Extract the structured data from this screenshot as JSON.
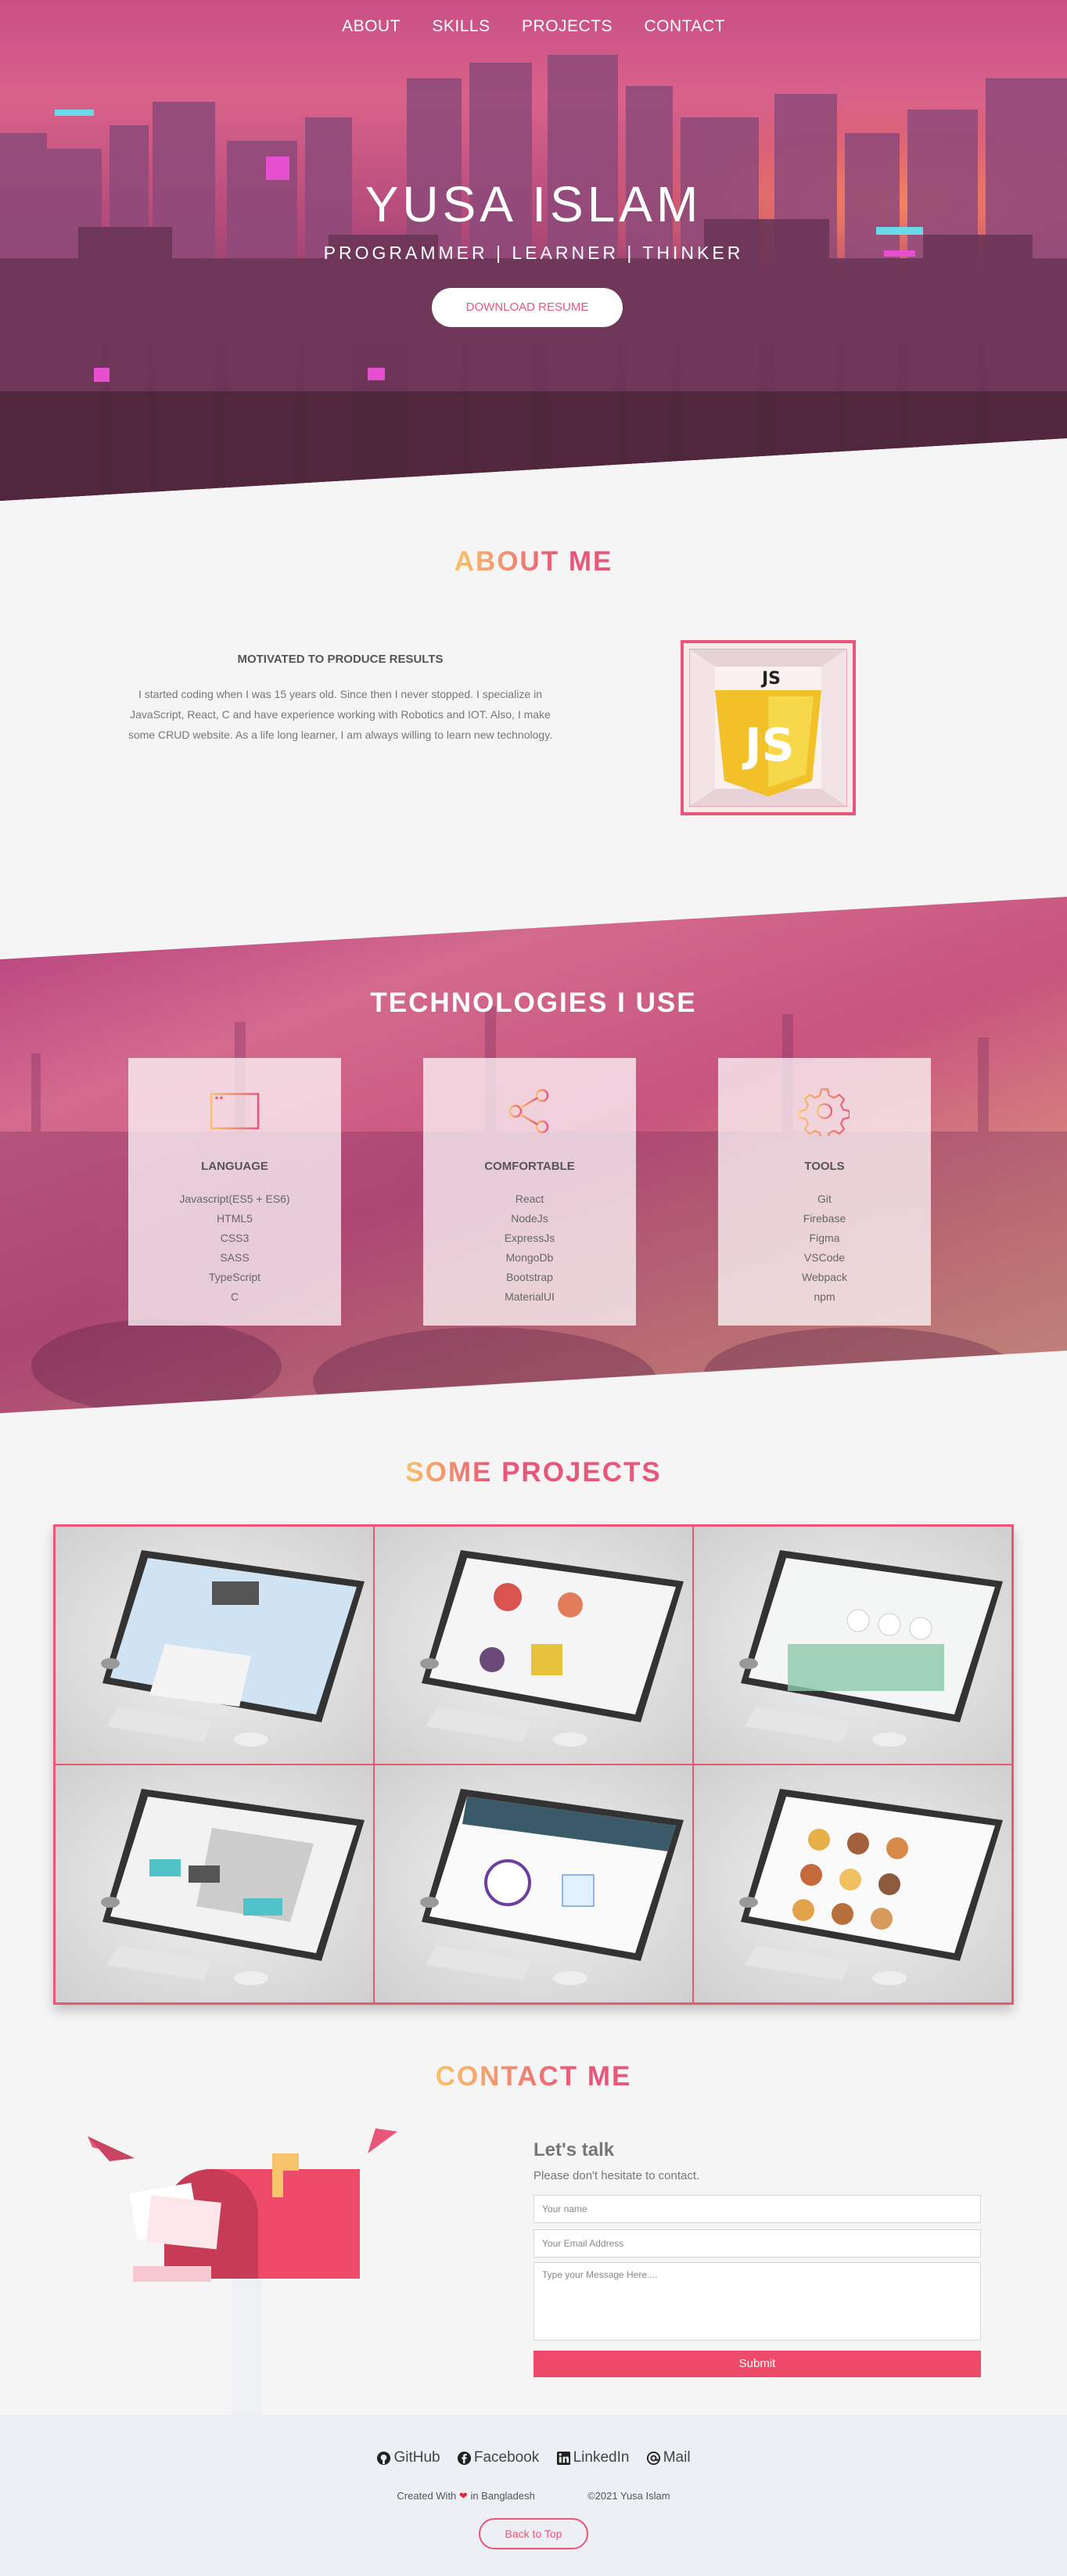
{
  "nav": {
    "items": [
      "ABOUT",
      "SKILLS",
      "PROJECTS",
      "CONTACT"
    ]
  },
  "hero": {
    "name": "YUSA ISLAM",
    "tagline": "PROGRAMMER | LEARNER | THINKER",
    "resume_button": "DOWNLOAD RESUME"
  },
  "about": {
    "title_a": "ABOUT",
    "title_b": "ME",
    "subtitle": "MOTIVATED TO PRODUCE RESULTS",
    "text": "I started coding when I was 15 years old. Since then I never stopped. I specialize in JavaScript, React, C and have experience working with Robotics and IOT. Also, I make some CRUD website. As a life long learner, I am always willing to learn new technology.",
    "logo_label": "JS"
  },
  "technologies": {
    "title": "TECHNOLOGIES I USE",
    "cards": [
      {
        "icon": "browser-window-icon",
        "title": "LANGUAGE",
        "items": [
          "Javascript(ES5 + ES6)",
          "HTML5",
          "CSS3",
          "SASS",
          "TypeScript",
          "C"
        ]
      },
      {
        "icon": "share-icon",
        "title": "COMFORTABLE",
        "items": [
          "React",
          "NodeJs",
          "ExpressJs",
          "MongoDb",
          "Bootstrap",
          "MaterialUI"
        ]
      },
      {
        "icon": "gear-icon",
        "title": "TOOLS",
        "items": [
          "Git",
          "Firebase",
          "Figma",
          "VSCode",
          "Webpack",
          "npm"
        ]
      }
    ]
  },
  "projects": {
    "title_a": "SOME",
    "title_b": "PROJECTS"
  },
  "contact": {
    "title_a": "CONTACT",
    "title_b": "ME",
    "heading": "Let's talk",
    "subtext": "Please don't hesitate to contact.",
    "name_placeholder": "Your name",
    "email_placeholder": "Your Email Address",
    "message_placeholder": "Type your Message Here....",
    "submit": "Submit"
  },
  "footer": {
    "links": [
      "GitHub",
      "Facebook",
      "LinkedIn",
      "Mail"
    ],
    "created_prefix": "Created With",
    "created_suffix": "in Bangladesh",
    "copyright": "©2021 Yusa Islam",
    "back_to_top": "Back to Top"
  },
  "colors": {
    "accent": "#e8577a",
    "gold": "#f7c36b",
    "footer_bg": "#eceff3"
  }
}
